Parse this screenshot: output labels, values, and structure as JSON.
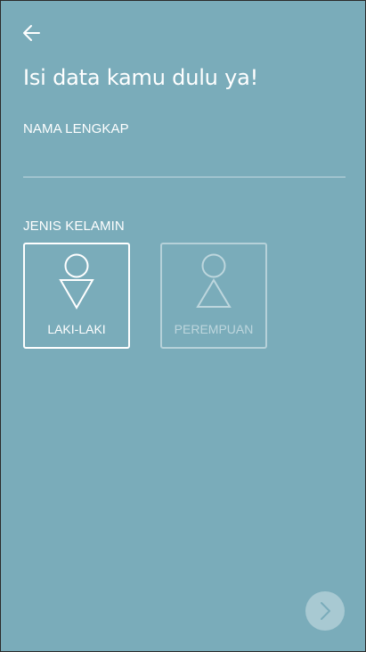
{
  "header": {
    "back_icon": "arrow-left-icon",
    "title": "Isi data kamu dulu ya!"
  },
  "form": {
    "name_label": "NAMA LENGKAP",
    "name_value": "",
    "gender_label": "JENIS KELAMIN",
    "gender_options": [
      {
        "label": "LAKI-LAKI",
        "icon": "male-figure-icon",
        "selected": true
      },
      {
        "label": "PEREMPUAN",
        "icon": "female-figure-icon",
        "selected": false
      }
    ]
  },
  "footer": {
    "next_icon": "chevron-right-icon"
  },
  "colors": {
    "background": "#7aacba",
    "foreground": "#ffffff"
  }
}
